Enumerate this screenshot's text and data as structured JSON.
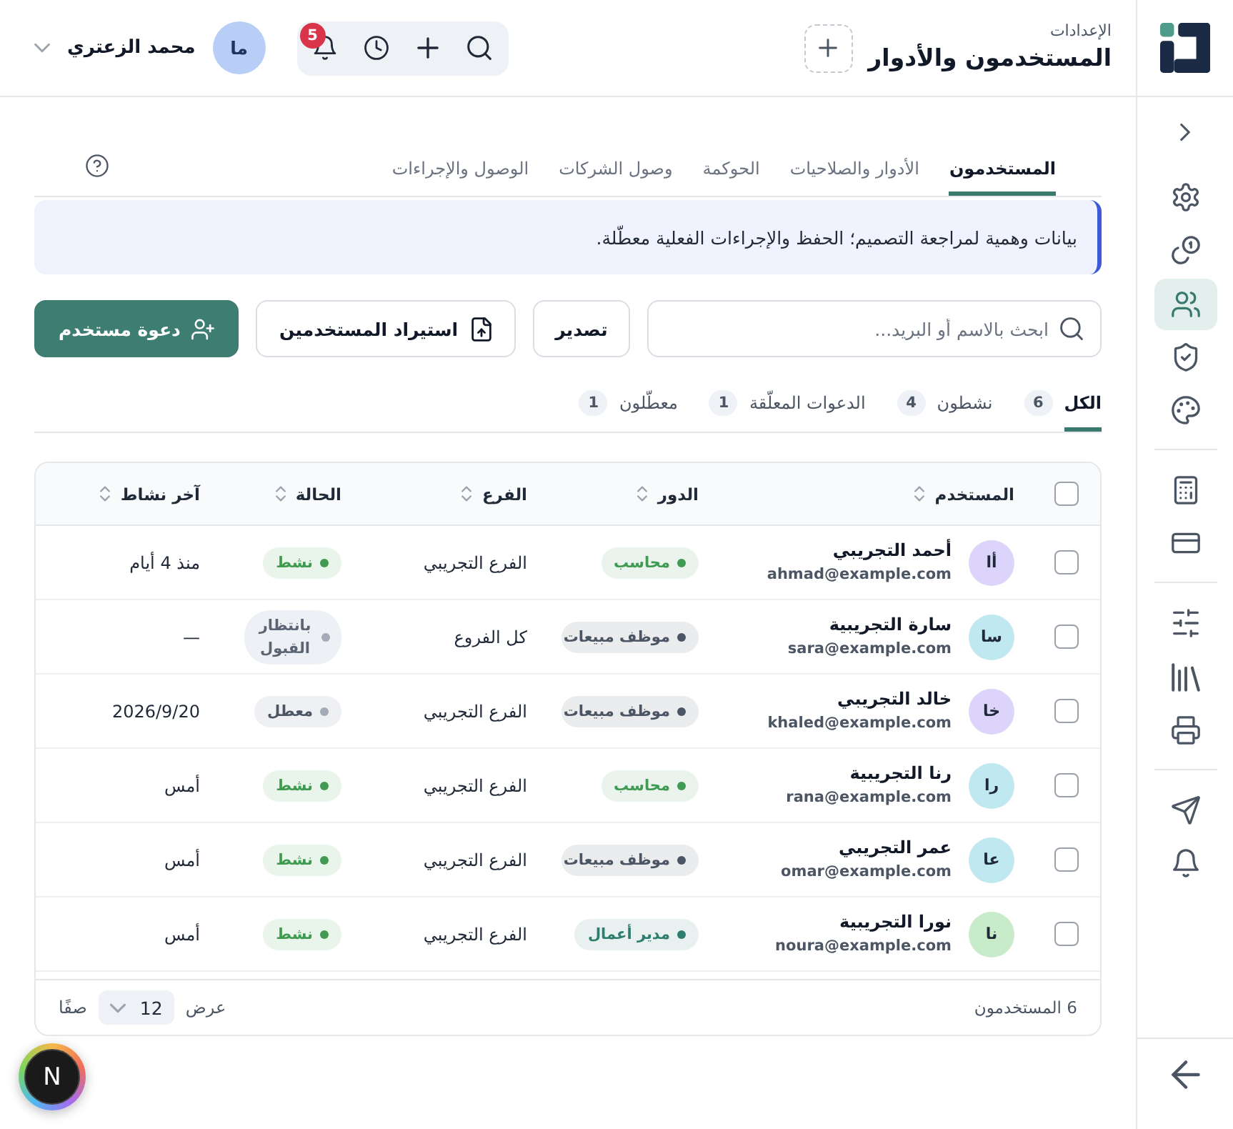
{
  "sidebar": {
    "groups": [
      {
        "items": [
          {
            "selected": false
          },
          {
            "selected": false
          },
          {
            "selected": true
          },
          {
            "selected": false
          },
          {
            "selected": false
          }
        ]
      },
      {
        "items": [
          {
            "selected": false
          },
          {
            "selected": false
          }
        ]
      },
      {
        "items": [
          {
            "selected": false
          },
          {
            "selected": false
          },
          {
            "selected": false
          }
        ]
      },
      {
        "items": [
          {
            "selected": false
          },
          {
            "selected": false
          }
        ]
      }
    ]
  },
  "header": {
    "breadcrumb": "الإعدادات",
    "title": "المستخدمون والأدوار",
    "notification_count": "5",
    "user": {
      "initials": "ما",
      "name": "محمد الزعتري"
    }
  },
  "tabs": [
    {
      "label": "المستخدمون",
      "selected": true
    },
    {
      "label": "الأدوار والصلاحيات",
      "selected": false
    },
    {
      "label": "الحوكمة",
      "selected": false
    },
    {
      "label": "وصول الشركات",
      "selected": false
    },
    {
      "label": "الوصول والإجراءات",
      "selected": false
    }
  ],
  "notice": "بيانات وهمية لمراجعة التصميم؛ الحفظ والإجراءات الفعلية معطّلة.",
  "toolbar": {
    "search": {
      "placeholder": "ابحث بالاسم أو البريد..."
    },
    "buttons": [
      {
        "label": "تصدير",
        "kind": "plain"
      },
      {
        "label": "استيراد المستخدمين",
        "kind": "import"
      },
      {
        "label": "دعوة مستخدم",
        "kind": "primary"
      }
    ]
  },
  "filters": [
    {
      "label": "الكل",
      "count": "6",
      "selected": true
    },
    {
      "label": "نشطون",
      "count": "4",
      "selected": false
    },
    {
      "label": "الدعوات المعلّقة",
      "count": "1",
      "selected": false
    },
    {
      "label": "معطّلون",
      "count": "1",
      "selected": false
    }
  ],
  "table": {
    "select_all": {
      "checked": false
    },
    "columns": [
      "المستخدم",
      "الدور",
      "الفرع",
      "الحالة",
      "آخر نشاط"
    ],
    "rows": [
      {
        "checked": false,
        "avatar": {
          "initials": "أا",
          "color": "#dcd4fa"
        },
        "name": "أحمد التجريبي",
        "email": "ahmad@example.com",
        "role": {
          "label": "محاسب",
          "color": "#3f9a52"
        },
        "branch": "الفرع التجريبي",
        "status": {
          "label": "نشط",
          "kind": "active"
        },
        "last_active": "منذ 4 أيام"
      },
      {
        "checked": false,
        "avatar": {
          "initials": "سا",
          "color": "#c0e8f0"
        },
        "name": "سارة التجريبية",
        "email": "sara@example.com",
        "role": {
          "label": "موظف مبيعات",
          "color": "#4b5563"
        },
        "branch": "كل الفروع",
        "status": {
          "label": "بانتظار القبول",
          "kind": "pending"
        },
        "last_active": "—"
      },
      {
        "checked": false,
        "avatar": {
          "initials": "خا",
          "color": "#dcd4fa"
        },
        "name": "خالد التجريبي",
        "email": "khaled@example.com",
        "role": {
          "label": "موظف مبيعات",
          "color": "#4b5563"
        },
        "branch": "الفرع التجريبي",
        "status": {
          "label": "معطل",
          "kind": "disabled"
        },
        "last_active": "2026/9/20"
      },
      {
        "checked": false,
        "avatar": {
          "initials": "را",
          "color": "#c0e8f0"
        },
        "name": "رنا التجريبية",
        "email": "rana@example.com",
        "role": {
          "label": "محاسب",
          "color": "#3f9a52"
        },
        "branch": "الفرع التجريبي",
        "status": {
          "label": "نشط",
          "kind": "active"
        },
        "last_active": "أمس"
      },
      {
        "checked": false,
        "avatar": {
          "initials": "عا",
          "color": "#c0e8f0"
        },
        "name": "عمر التجريبي",
        "email": "omar@example.com",
        "role": {
          "label": "موظف مبيعات",
          "color": "#4b5563"
        },
        "branch": "الفرع التجريبي",
        "status": {
          "label": "نشط",
          "kind": "active"
        },
        "last_active": "أمس"
      },
      {
        "checked": false,
        "avatar": {
          "initials": "نا",
          "color": "#c8ecca"
        },
        "name": "نورا التجريبية",
        "email": "noura@example.com",
        "role": {
          "label": "مدير أعمال",
          "color": "#2e7d6f"
        },
        "branch": "الفرع التجريبي",
        "status": {
          "label": "نشط",
          "kind": "active"
        },
        "last_active": "أمس"
      }
    ],
    "footer": {
      "total": "6 المستخدمون",
      "show_label": "عرض",
      "page_size": "12",
      "rows_label": "صفًا"
    }
  },
  "dev_tools": {
    "label": "N"
  }
}
